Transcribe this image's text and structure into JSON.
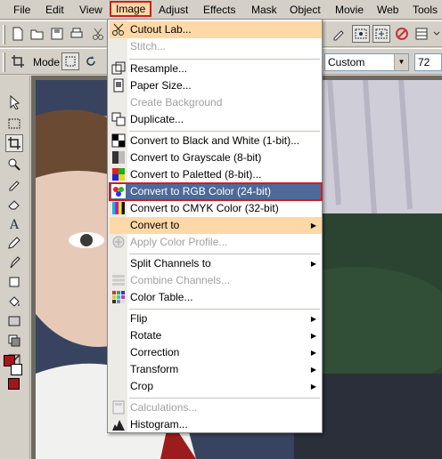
{
  "menubar": {
    "items": [
      "File",
      "Edit",
      "View",
      "Image",
      "Adjust",
      "Effects",
      "Mask",
      "Object",
      "Movie",
      "Web",
      "Tools"
    ],
    "active": "Image"
  },
  "toolbar2": {
    "mode_label": "Mode",
    "preset_value": "Custom",
    "size_value": "72"
  },
  "image_menu": {
    "items": [
      {
        "label": "Cutout Lab...",
        "icon": "scissors-icon",
        "state": "hover"
      },
      {
        "label": "Stitch...",
        "icon": "",
        "state": "disabled"
      },
      {
        "label": "Resample...",
        "icon": "resample-icon",
        "state": "normal"
      },
      {
        "label": "Paper Size...",
        "icon": "paper-size-icon",
        "state": "normal"
      },
      {
        "label": "Create Background",
        "icon": "",
        "state": "disabled"
      },
      {
        "label": "Duplicate...",
        "icon": "duplicate-icon",
        "state": "normal"
      },
      {
        "label": "Convert to Black and White (1-bit)...",
        "icon": "black-white-icon",
        "state": "normal"
      },
      {
        "label": "Convert to Grayscale (8-bit)",
        "icon": "grayscale-icon",
        "state": "normal"
      },
      {
        "label": "Convert to Paletted (8-bit)...",
        "icon": "paletted-icon",
        "state": "normal"
      },
      {
        "label": "Convert to RGB Color (24-bit)",
        "icon": "rgb-icon",
        "state": "selected"
      },
      {
        "label": "Convert to CMYK Color (32-bit)",
        "icon": "cmyk-icon",
        "state": "normal"
      },
      {
        "label": "Convert to",
        "icon": "",
        "state": "hover",
        "submenu": true
      },
      {
        "label": "Apply Color Profile...",
        "icon": "color-profile-icon",
        "state": "disabled"
      },
      {
        "label": "Split Channels to",
        "icon": "",
        "state": "normal",
        "submenu": true
      },
      {
        "label": "Combine Channels...",
        "icon": "combine-channels-icon",
        "state": "disabled"
      },
      {
        "label": "Color Table...",
        "icon": "color-table-icon",
        "state": "normal"
      },
      {
        "label": "Flip",
        "icon": "",
        "state": "normal",
        "submenu": true
      },
      {
        "label": "Rotate",
        "icon": "",
        "state": "normal",
        "submenu": true
      },
      {
        "label": "Correction",
        "icon": "",
        "state": "normal",
        "submenu": true
      },
      {
        "label": "Transform",
        "icon": "",
        "state": "normal",
        "submenu": true
      },
      {
        "label": "Crop",
        "icon": "",
        "state": "normal",
        "submenu": true
      },
      {
        "label": "Calculations...",
        "icon": "calculations-icon",
        "state": "disabled"
      },
      {
        "label": "Histogram...",
        "icon": "histogram-icon",
        "state": "normal"
      }
    ]
  },
  "colors": {
    "menu_hover": "#ffd8a8",
    "menu_selected": "#4e6a9c",
    "highlight_outline": "#cc1f1f",
    "foreground_swatch": "#a8141c"
  }
}
